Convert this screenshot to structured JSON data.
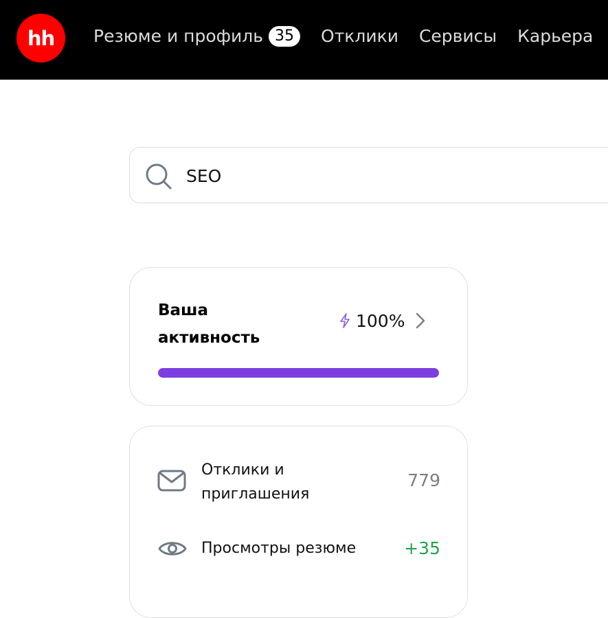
{
  "header": {
    "logo_text": "hh",
    "nav": [
      {
        "label": "Резюме и профиль",
        "badge": "35"
      },
      {
        "label": "Отклики"
      },
      {
        "label": "Сервисы"
      },
      {
        "label": "Карьера"
      }
    ]
  },
  "search": {
    "value": "SEO",
    "icon": "search-icon"
  },
  "activity": {
    "title": "Ваша активность",
    "value": "100%",
    "progress": 1.0,
    "icons": [
      "lightning-icon",
      "chevron-right-icon"
    ]
  },
  "stats": [
    {
      "label": "Отклики и приглашения",
      "value": "779",
      "icon": "envelope-icon",
      "value_color": "#7c8086"
    },
    {
      "label": "Просмотры резюме",
      "value": "+35",
      "icon": "eye-icon",
      "value_color": "#1fa350"
    }
  ],
  "colors": {
    "brand": "#ff0000",
    "accent": "#7d3ee0",
    "positive": "#1fa350"
  }
}
